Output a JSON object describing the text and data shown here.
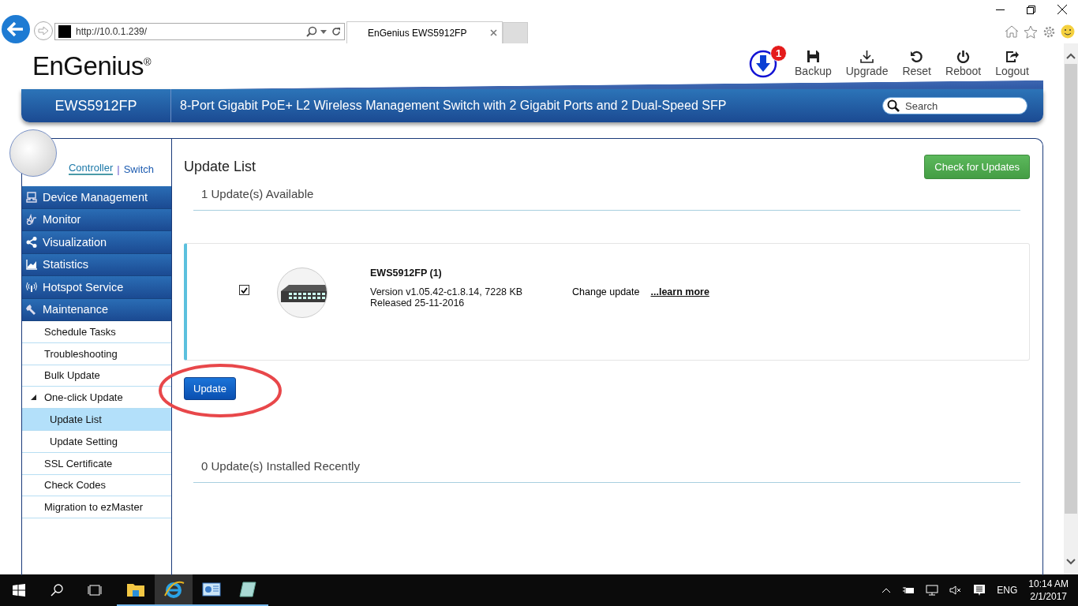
{
  "browser": {
    "address": "http://10.0.1.239/",
    "tab_title": "EnGenius EWS5912FP"
  },
  "header": {
    "logo": "EnGenius$^{®}$",
    "notification_count": "1",
    "actions": [
      {
        "label": "Backup",
        "kind": "save"
      },
      {
        "label": "Upgrade",
        "kind": "download"
      },
      {
        "label": "Reset",
        "kind": "reset"
      },
      {
        "label": "Reboot",
        "kind": "power"
      },
      {
        "label": "Logout",
        "kind": "logout"
      }
    ],
    "model": "EWS5912FP",
    "description": "8-Port Gigabit PoE+ L2 Wireless Management Switch with 2 Gigabit Ports and 2 Dual-Speed SFP",
    "search": {
      "placeholder": "Search"
    }
  },
  "sidebar": {
    "mode_links": [
      {
        "label": "Controller",
        "selected": true
      },
      {
        "label": "Switch",
        "selected": false
      }
    ],
    "separator": "|",
    "menu": [
      {
        "label": "Device Management",
        "kind": "device"
      },
      {
        "label": "Monitor",
        "kind": "monitor"
      },
      {
        "label": "Visualization",
        "kind": "share"
      },
      {
        "label": "Statistics",
        "kind": "chart"
      },
      {
        "label": "Hotspot Service",
        "kind": "wireless"
      },
      {
        "label": "Maintenance",
        "kind": "wrench",
        "children": [
          {
            "label": "Schedule Tasks",
            "selected": false
          },
          {
            "label": "Troubleshooting",
            "selected": false
          },
          {
            "label": "Bulk Update",
            "selected": false
          },
          {
            "label": "One-click Update",
            "selected": false,
            "expanded": true,
            "children": [
              {
                "label": "Update List",
                "selected": true
              },
              {
                "label": "Update Setting",
                "selected": false
              }
            ]
          },
          {
            "label": "SSL Certificate",
            "selected": false
          },
          {
            "label": "Check Codes",
            "selected": false
          },
          {
            "label": "Migration to ezMaster",
            "selected": false
          }
        ]
      }
    ]
  },
  "main": {
    "title": "Update List",
    "check_button": "Check for Updates",
    "available_heading": "1 Update(s) Available",
    "updates": [
      {
        "checked": true,
        "name": "EWS5912FP (1)",
        "version": "Version v1.05.42-c1.8.14, 7228 KB",
        "released": "Released 25-11-2016",
        "change_label": "Change update",
        "learn_more": "...learn more"
      }
    ],
    "update_button": "Update",
    "installed_heading": "0 Update(s) Installed Recently"
  },
  "taskbar": {
    "apps": [
      {
        "kind": "folder",
        "active": false
      },
      {
        "kind": "browser",
        "active": true
      },
      {
        "kind": "dashboard",
        "active": false
      },
      {
        "kind": "notepad",
        "active": false
      }
    ],
    "language": "ENG",
    "time": "10:14 AM",
    "date": "2/1/2017"
  }
}
